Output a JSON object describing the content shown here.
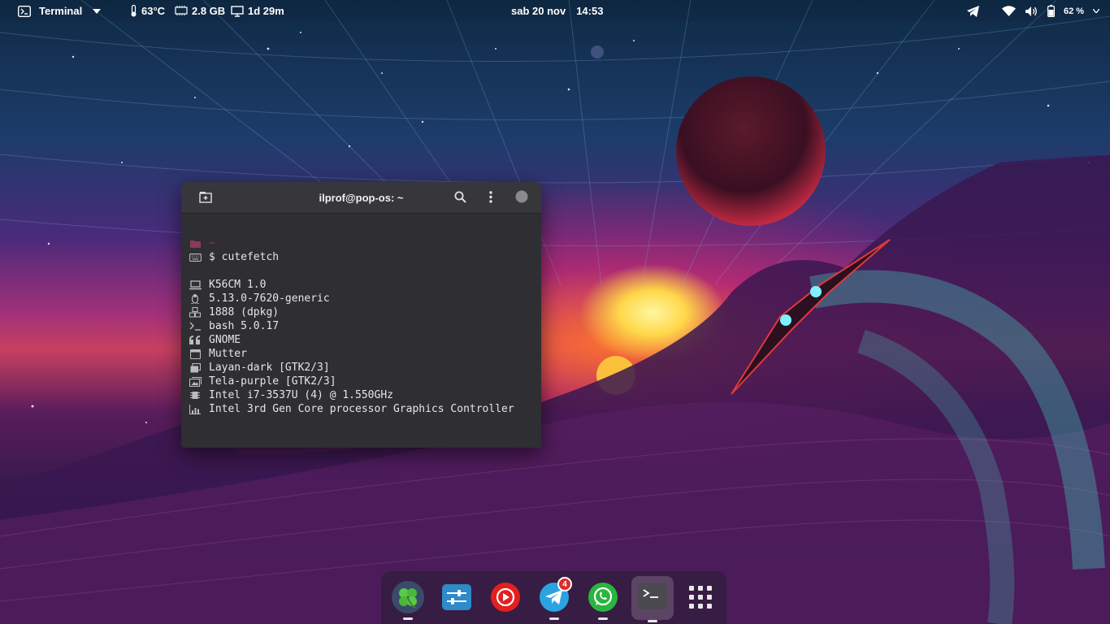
{
  "topbar": {
    "app_name": "Terminal",
    "temperature": "63°C",
    "memory": "2.8 GB",
    "uptime": "1d 29m",
    "date": "sab 20 nov",
    "time": "14:53",
    "battery": "62 %"
  },
  "terminal": {
    "title": "ilprof@pop-os: ~",
    "cwd": "~",
    "prompt": "$ cutefetch",
    "info": [
      {
        "icon": "laptop-icon",
        "text": "K56CM 1.0"
      },
      {
        "icon": "linux-icon",
        "text": "5.13.0-7620-generic"
      },
      {
        "icon": "packages-icon",
        "text": "1888 (dpkg)"
      },
      {
        "icon": "shell-icon",
        "text": "bash 5.0.17"
      },
      {
        "icon": "quote-icon",
        "text": "GNOME"
      },
      {
        "icon": "window-manager-icon",
        "text": "Mutter"
      },
      {
        "icon": "theme-icon",
        "text": "Layan-dark [GTK2/3]"
      },
      {
        "icon": "icons-theme-icon",
        "text": "Tela-purple [GTK2/3]"
      },
      {
        "icon": "cpu-icon",
        "text": "Intel i7-3537U (4) @ 1.550GHz"
      },
      {
        "icon": "gpu-icon",
        "text": "Intel 3rd Gen Core processor Graphics Controller"
      }
    ]
  },
  "dock": {
    "telegram_badge": "4",
    "apps": [
      "clover-app",
      "settings-app",
      "youtube-music-app",
      "telegram-app",
      "whatsapp-app",
      "terminal-app",
      "show-apps"
    ]
  },
  "colors": {
    "terminal_bg": "#2e2e33",
    "telegram": "#2aa3e0",
    "whatsapp": "#29b53e",
    "ytmusic": "#e22020",
    "badge": "#e02b2b"
  }
}
